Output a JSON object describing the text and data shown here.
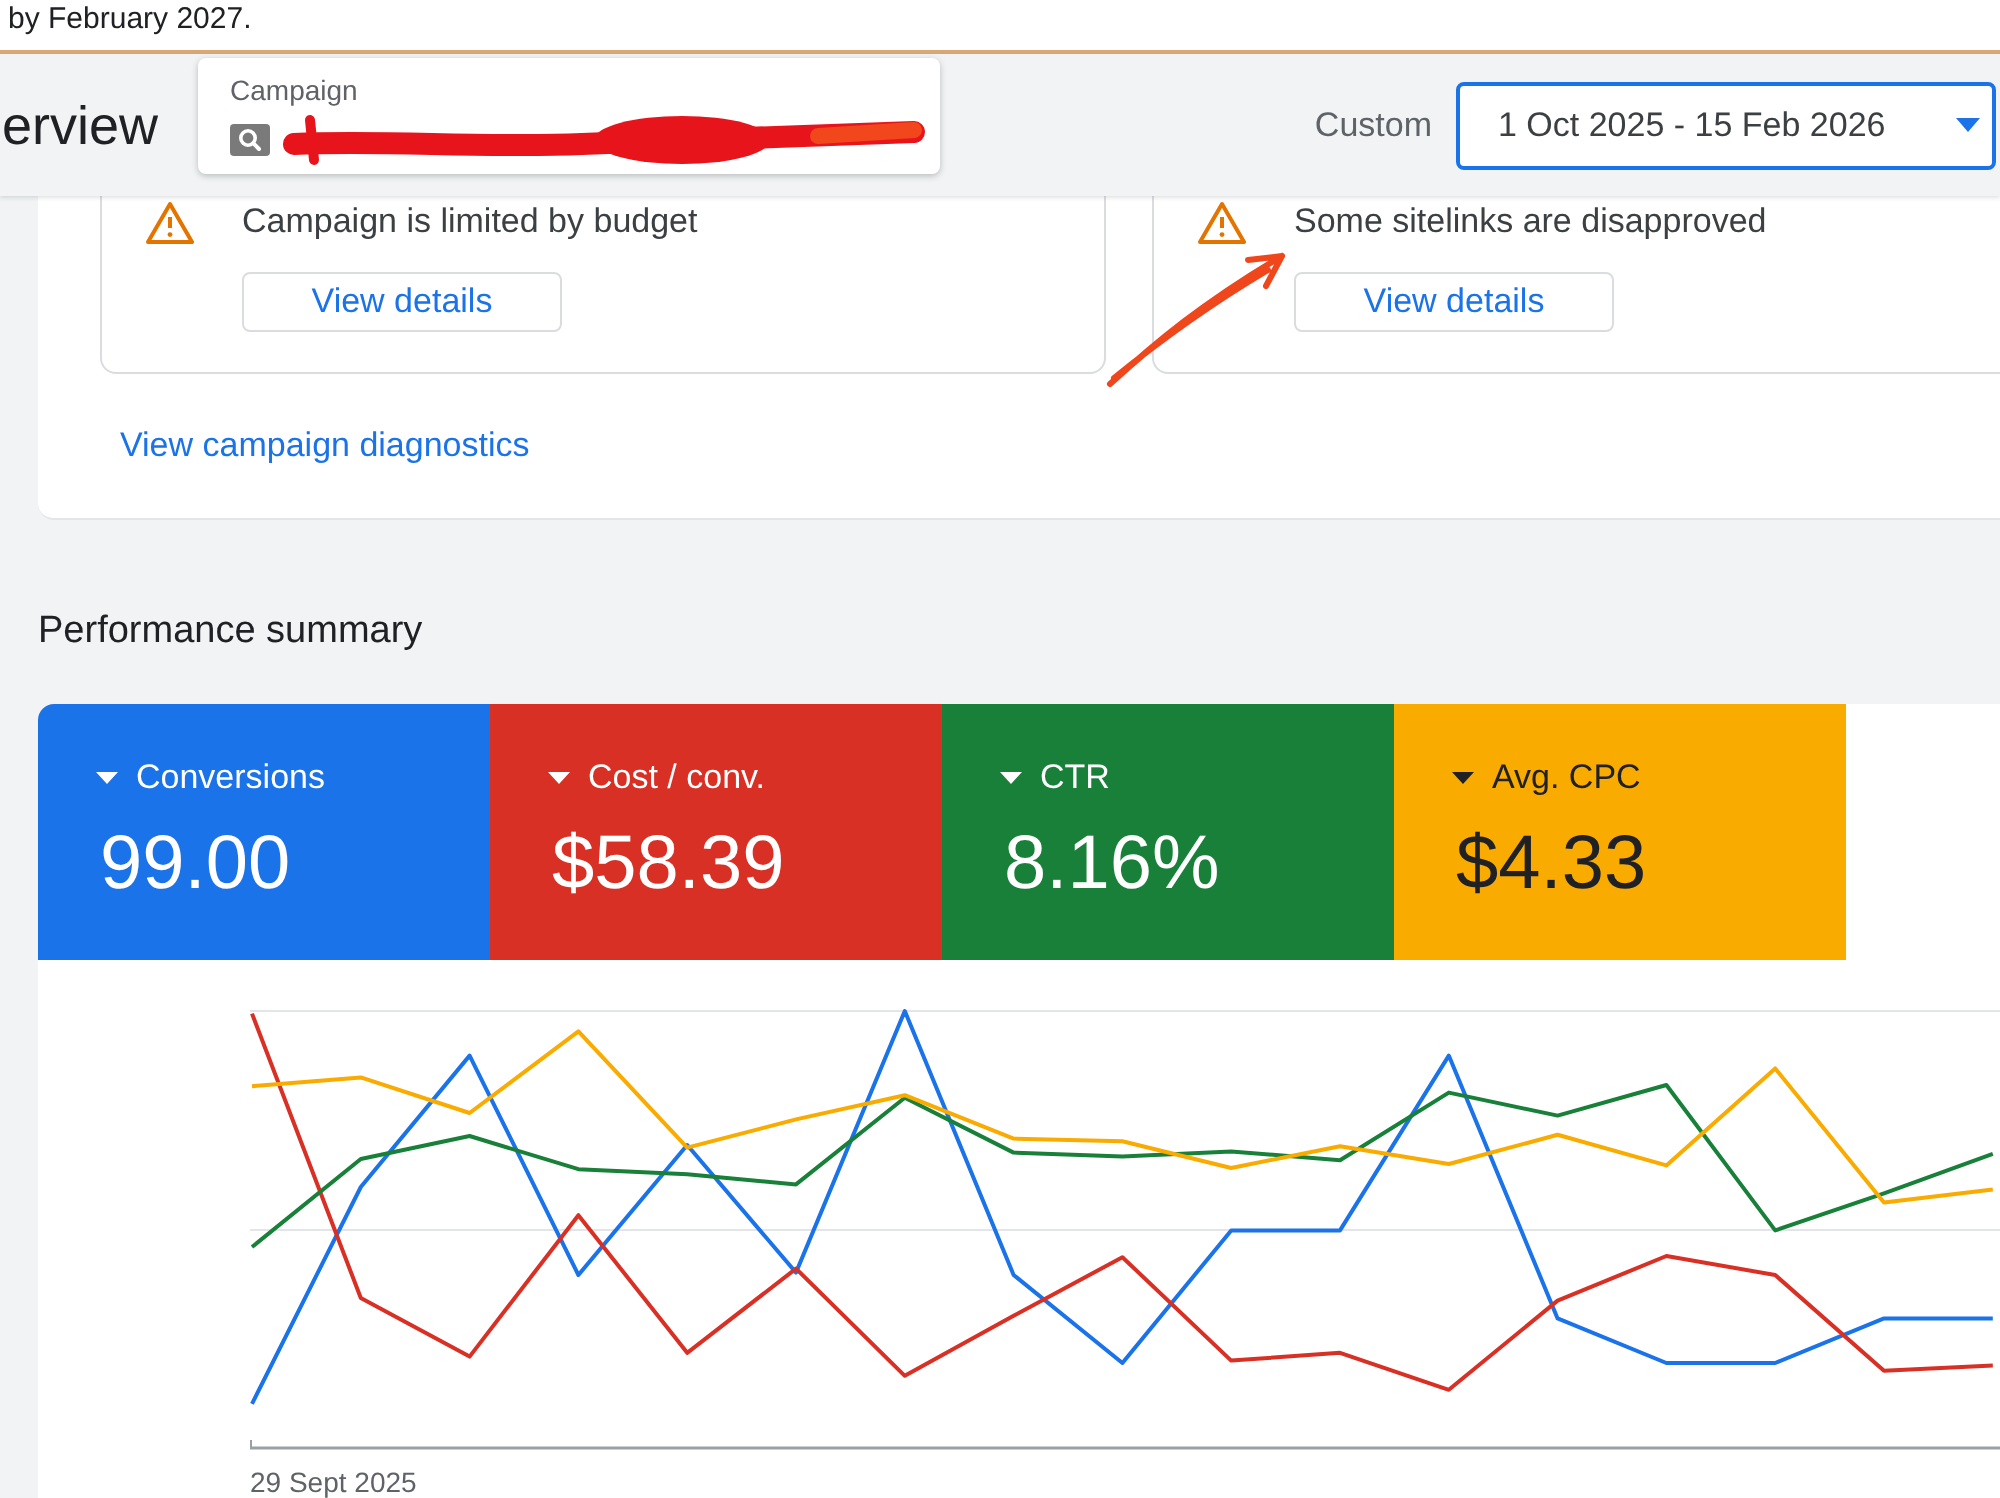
{
  "notice": {
    "text": "by February 2027."
  },
  "header": {
    "title": "erview",
    "campaign_selector": {
      "label": "Campaign"
    },
    "date_range": {
      "preset": "Custom",
      "value": "1 Oct 2025 - 15 Feb 2026"
    }
  },
  "diagnostics": {
    "alerts": [
      {
        "message": "Campaign is limited by budget",
        "button": "View details"
      },
      {
        "message": "Some sitelinks are disapproved",
        "button": "View details"
      }
    ],
    "link": "View campaign diagnostics"
  },
  "performance_summary": {
    "title": "Performance summary",
    "metrics": [
      {
        "label": "Conversions",
        "value": "99.00",
        "color": "#1a73e8",
        "selected": true
      },
      {
        "label": "Cost / conv.",
        "value": "$58.39",
        "color": "#d93025",
        "selected": true
      },
      {
        "label": "CTR",
        "value": "8.16%",
        "color": "#188038",
        "selected": true
      },
      {
        "label": "Avg. CPC",
        "value": "$4.33",
        "color": "#f9ab00",
        "selected": true
      }
    ],
    "chart": {
      "axis_start_label": "29 Sept 2025"
    }
  }
}
